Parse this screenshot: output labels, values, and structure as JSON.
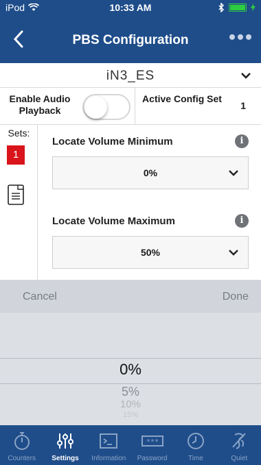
{
  "status": {
    "carrier": "iPod",
    "time": "10:33 AM"
  },
  "nav": {
    "title": "PBS Configuration"
  },
  "config": {
    "name": "iN3_ES"
  },
  "audio": {
    "label": "Enable Audio Playback",
    "enabled": false,
    "active_label": "Active Config Set",
    "active_value": "1"
  },
  "sets": {
    "label": "Sets:",
    "current": "1"
  },
  "settings": [
    {
      "title": "Locate Volume Minimum",
      "value": "0%"
    },
    {
      "title": "Locate Volume Maximum",
      "value": "50%"
    }
  ],
  "picker": {
    "cancel": "Cancel",
    "done": "Done",
    "selected": "0%",
    "options_below": [
      "5%",
      "10%",
      "15%"
    ]
  },
  "tabs": [
    {
      "label": "Counters",
      "icon": "stopwatch-icon"
    },
    {
      "label": "Settings",
      "icon": "sliders-icon",
      "active": true
    },
    {
      "label": "Information",
      "icon": "terminal-icon"
    },
    {
      "label": "Password",
      "icon": "password-icon"
    },
    {
      "label": "Time",
      "icon": "clock-icon"
    },
    {
      "label": "Quiet",
      "icon": "quiet-icon"
    }
  ],
  "colors": {
    "nav_bg": "#1f4d8a",
    "set_badge": "#d9151b",
    "battery": "#2ecc40"
  }
}
